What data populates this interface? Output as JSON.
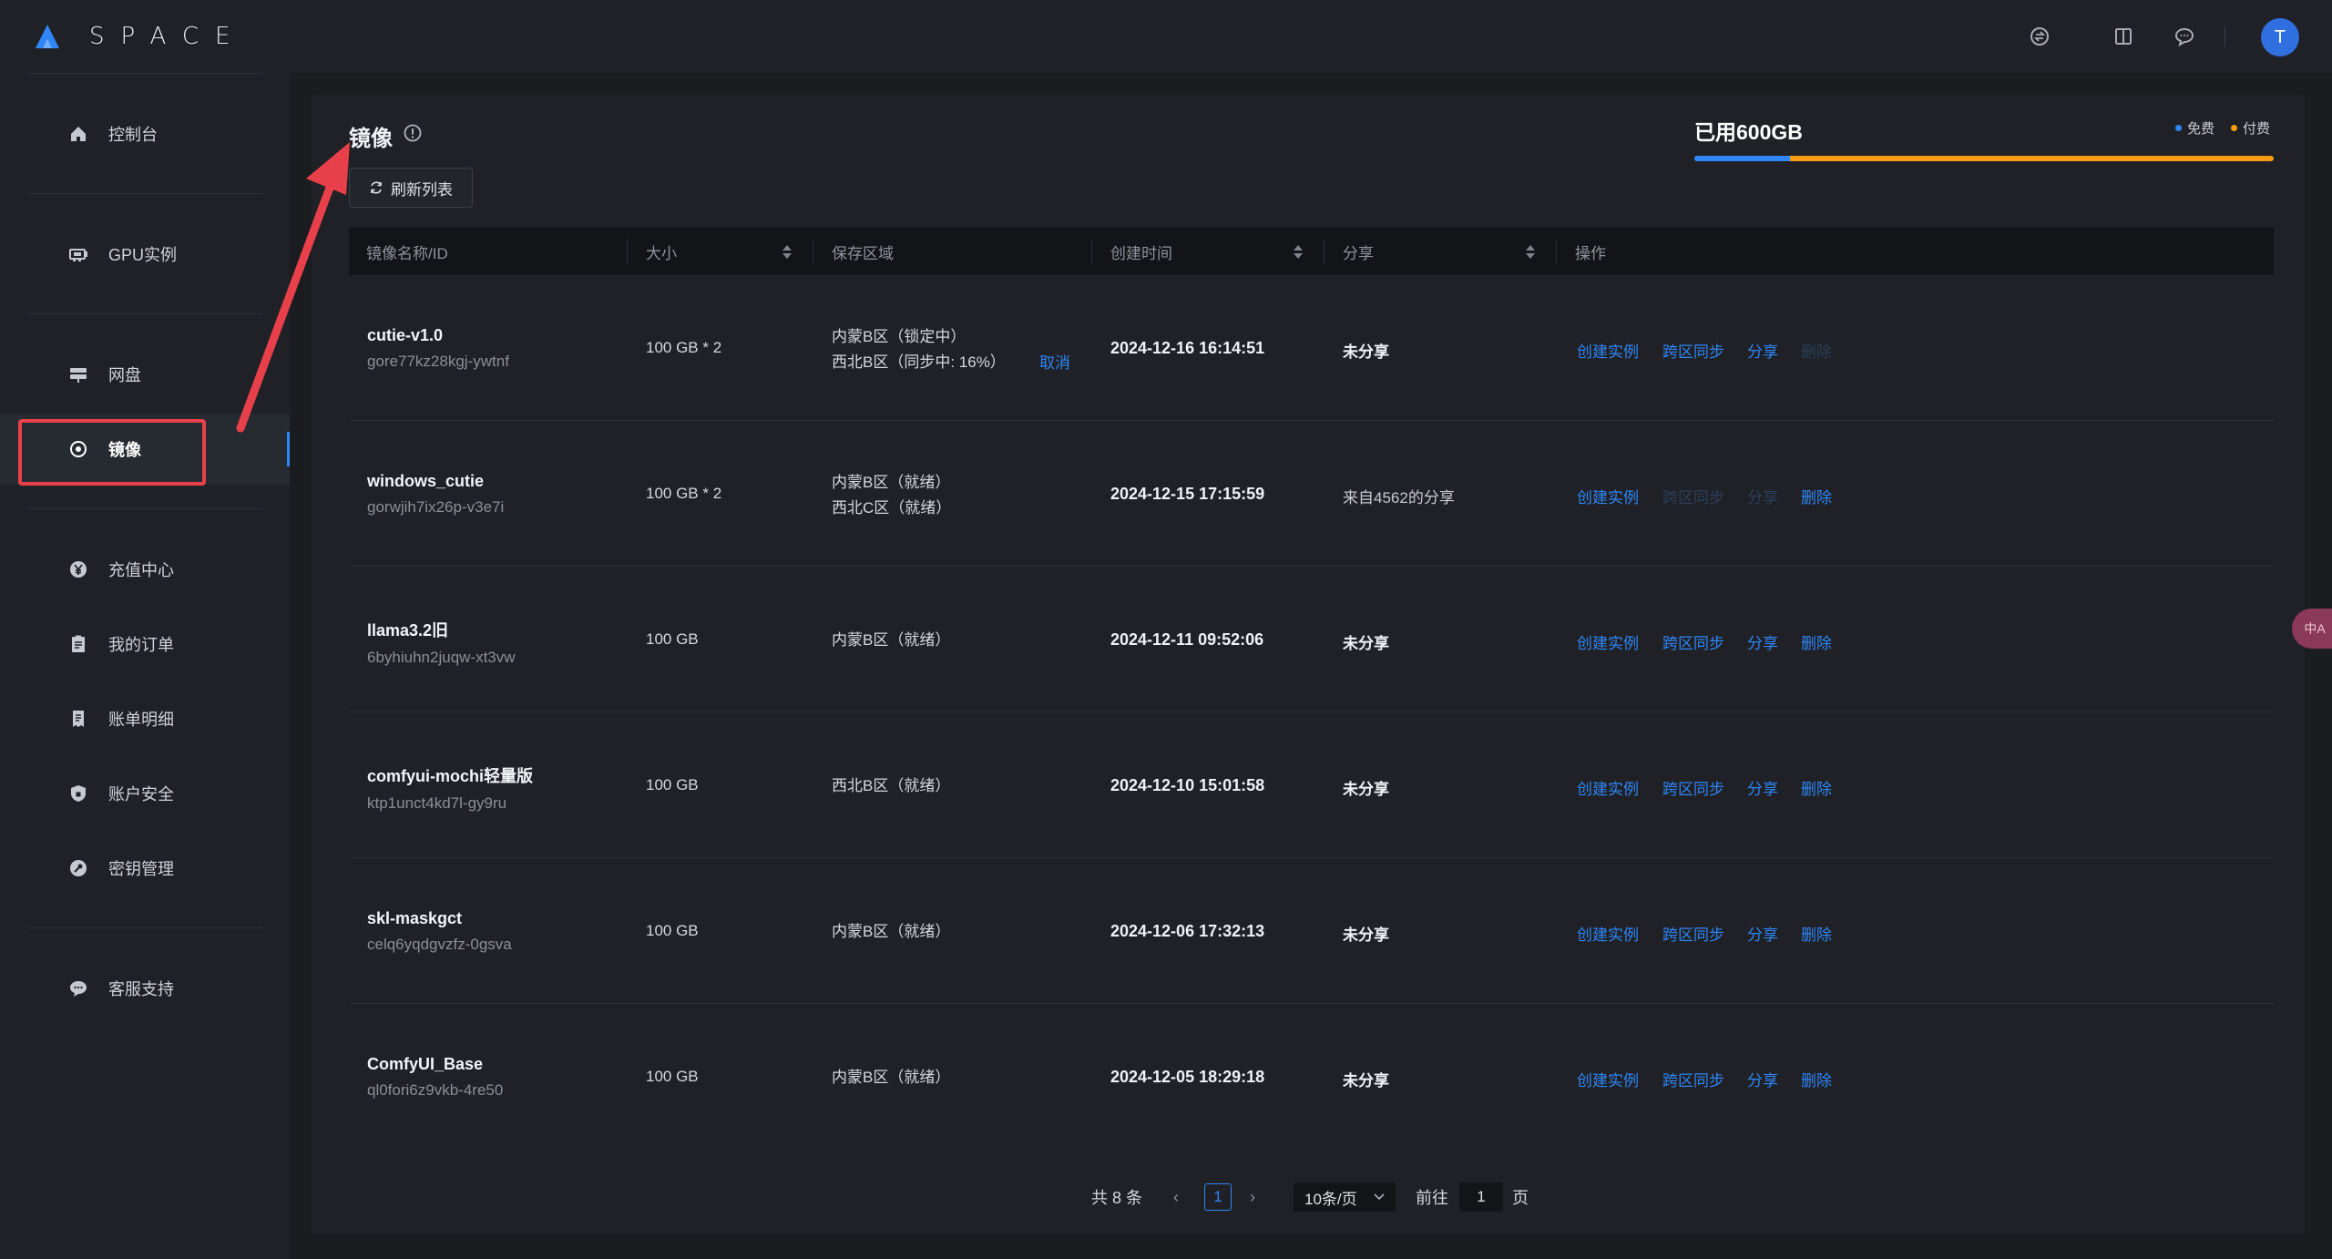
{
  "brand": {
    "name": "SPACE",
    "logo_icon": "a-triangle-logo",
    "accent": "#2f86f6"
  },
  "sidebar": {
    "items": [
      {
        "label": "控制台",
        "icon": "home-icon"
      },
      {
        "label": "GPU实例",
        "icon": "gpu-icon"
      },
      {
        "label": "网盘",
        "icon": "disk-icon"
      },
      {
        "label": "镜像",
        "icon": "image-disc-icon",
        "active": true
      },
      {
        "label": "充值中心",
        "icon": "yen-icon"
      },
      {
        "label": "我的订单",
        "icon": "order-icon"
      },
      {
        "label": "账单明细",
        "icon": "bill-icon"
      },
      {
        "label": "账户安全",
        "icon": "shield-icon"
      },
      {
        "label": "密钥管理",
        "icon": "key-icon"
      },
      {
        "label": "客服支持",
        "icon": "chat-icon"
      }
    ]
  },
  "topbar": {
    "icons": [
      "exchange-icon",
      "book-icon",
      "message-icon"
    ],
    "avatar_letter": "T"
  },
  "page": {
    "title": "镜像",
    "refresh_label": "刷新列表"
  },
  "usage": {
    "label": "已用600GB",
    "legend_free": "免费",
    "legend_paid": "付费",
    "free_color": "#2f86f6",
    "paid_color": "#f59b14",
    "free_fraction": 0.165
  },
  "table": {
    "columns": [
      "镜像名称/ID",
      "大小",
      "保存区域",
      "创建时间",
      "分享",
      "操作"
    ],
    "rows": [
      {
        "name": "cutie-v1.0",
        "id": "gore77kz28kgj-ywtnf",
        "size": "100 GB * 2",
        "regions": [
          "内蒙B区（锁定中）",
          "西北B区（同步中: 16%）"
        ],
        "cancel": "取消",
        "created": "2024-12-16 16:14:51",
        "share": "未分享",
        "actions": {
          "create": "创建实例",
          "sync": "跨区同步",
          "share": "分享",
          "delete": "删除"
        }
      },
      {
        "name": "windows_cutie",
        "id": "gorwjih7ix26p-v3e7i",
        "size": "100 GB * 2",
        "regions": [
          "内蒙B区（就绪）",
          "西北C区（就绪）"
        ],
        "cancel": "",
        "created": "2024-12-15 17:15:59",
        "share": "来自4562的分享",
        "actions": {
          "create": "创建实例",
          "sync": "跨区同步",
          "share": "分享",
          "delete": "删除"
        }
      },
      {
        "name": "llama3.2旧",
        "id": "6byhiuhn2juqw-xt3vw",
        "size": "100 GB",
        "regions": [
          "内蒙B区（就绪）"
        ],
        "cancel": "",
        "created": "2024-12-11 09:52:06",
        "share": "未分享",
        "actions": {
          "create": "创建实例",
          "sync": "跨区同步",
          "share": "分享",
          "delete": "删除"
        }
      },
      {
        "name": "comfyui-mochi轻量版",
        "id": "ktp1unct4kd7l-gy9ru",
        "size": "100 GB",
        "regions": [
          "西北B区（就绪）"
        ],
        "cancel": "",
        "created": "2024-12-10 15:01:58",
        "share": "未分享",
        "actions": {
          "create": "创建实例",
          "sync": "跨区同步",
          "share": "分享",
          "delete": "删除"
        }
      },
      {
        "name": "skl-maskgct",
        "id": "celq6yqdgvzfz-0gsva",
        "size": "100 GB",
        "regions": [
          "内蒙B区（就绪）"
        ],
        "cancel": "",
        "created": "2024-12-06 17:32:13",
        "share": "未分享",
        "actions": {
          "create": "创建实例",
          "sync": "跨区同步",
          "share": "分享",
          "delete": "删除"
        }
      },
      {
        "name": "ComfyUI_Base",
        "id": "ql0fori6z9vkb-4re50",
        "size": "100 GB",
        "regions": [
          "内蒙B区（就绪）"
        ],
        "cancel": "",
        "created": "2024-12-05 18:29:18",
        "share": "未分享",
        "actions": {
          "create": "创建实例",
          "sync": "跨区同步",
          "share": "分享",
          "delete": "删除"
        }
      }
    ]
  },
  "pagination": {
    "total": "共 8 条",
    "current_page": "1",
    "page_size": "10条/页",
    "goto_label": "前往",
    "goto_value": "1",
    "page_suffix": "页"
  },
  "float_button": {
    "label": "中A",
    "icon": "translate-icon"
  },
  "annotation": {
    "color": "#e8404a"
  }
}
